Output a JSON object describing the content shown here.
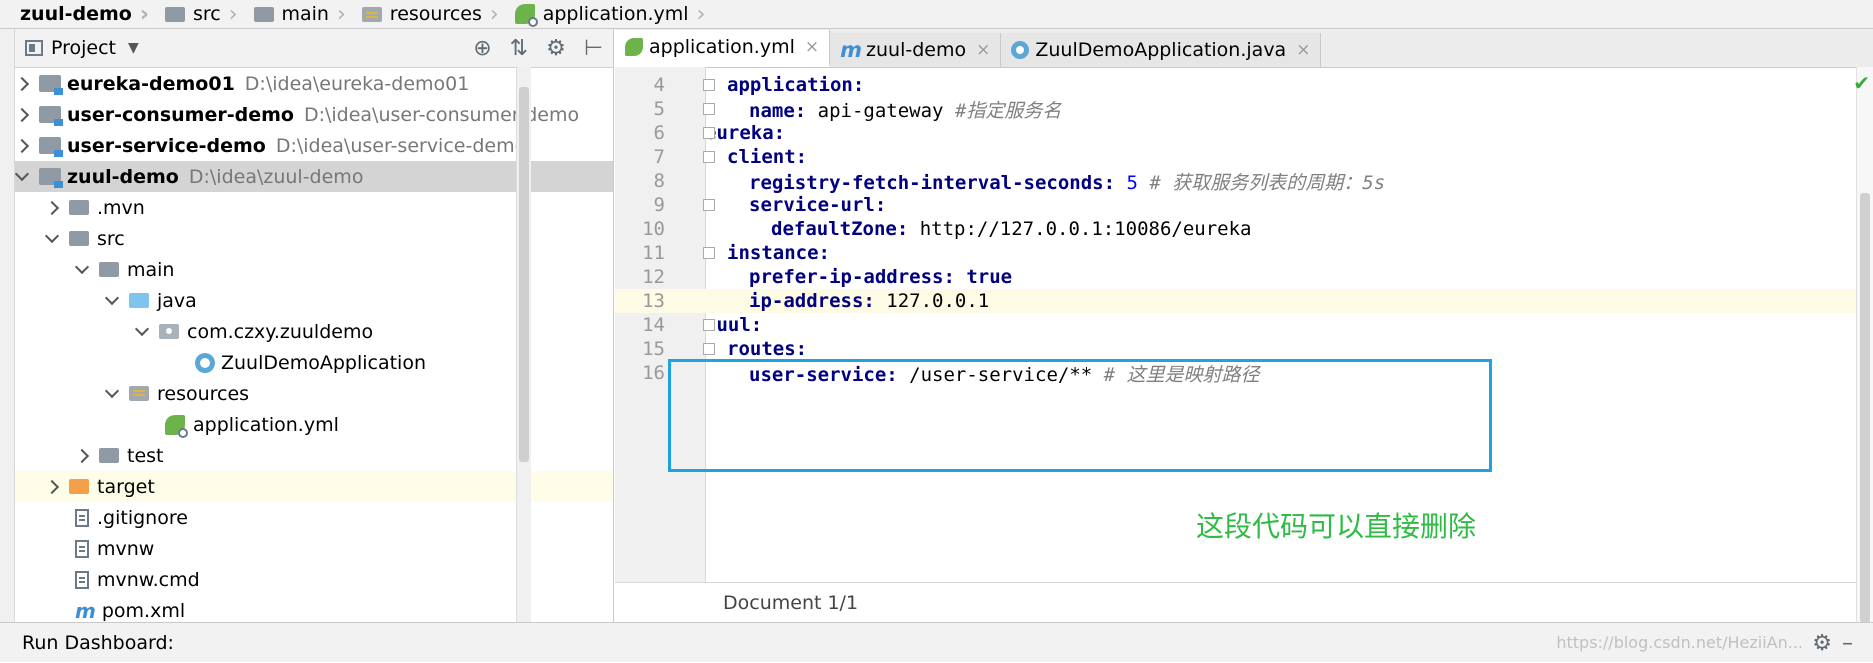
{
  "breadcrumb": [
    "zuul-demo",
    "src",
    "main",
    "resources",
    "application.yml"
  ],
  "project_panel": {
    "title": "Project",
    "tree": [
      {
        "label": "eureka-demo01",
        "path": "D:\\idea\\eureka-demo01",
        "type": "module",
        "expanded": false
      },
      {
        "label": "user-consumer-demo",
        "path": "D:\\idea\\user-consumer-demo",
        "type": "module",
        "expanded": false
      },
      {
        "label": "user-service-demo",
        "path": "D:\\idea\\user-service-demo",
        "type": "module",
        "expanded": false
      },
      {
        "label": "zuul-demo",
        "path": "D:\\idea\\zuul-demo",
        "type": "module",
        "expanded": true,
        "selected": true
      },
      {
        "label": ".mvn",
        "type": "folder"
      },
      {
        "label": "src",
        "type": "folder"
      },
      {
        "label": "main",
        "type": "folder"
      },
      {
        "label": "java",
        "type": "source-folder"
      },
      {
        "label": "com.czxy.zuuldemo",
        "type": "package"
      },
      {
        "label": "ZuulDemoApplication",
        "type": "class"
      },
      {
        "label": "resources",
        "type": "resources-folder"
      },
      {
        "label": "application.yml",
        "type": "yml"
      },
      {
        "label": "test",
        "type": "folder"
      },
      {
        "label": "target",
        "type": "excluded-folder"
      },
      {
        "label": ".gitignore",
        "type": "file"
      },
      {
        "label": "mvnw",
        "type": "file"
      },
      {
        "label": "mvnw.cmd",
        "type": "file"
      },
      {
        "label": "pom.xml",
        "type": "maven"
      }
    ]
  },
  "editor": {
    "tabs": [
      {
        "label": "application.yml",
        "active": true,
        "close": "×"
      },
      {
        "label": "zuul-demo",
        "active": false,
        "close": "×"
      },
      {
        "label": "ZuulDemoApplication.java",
        "active": false,
        "close": "×"
      }
    ],
    "lines": [
      {
        "n": "4",
        "indent": 1,
        "key": "application:",
        "value": "",
        "comment": ""
      },
      {
        "n": "5",
        "indent": 2,
        "key": "name:",
        "value": "api-gateway",
        "comment": "#指定服务名"
      },
      {
        "n": "6",
        "indent": 0,
        "key": "eureka:",
        "value": "",
        "comment": ""
      },
      {
        "n": "7",
        "indent": 1,
        "key": "client:",
        "value": "",
        "comment": ""
      },
      {
        "n": "8",
        "indent": 2,
        "key": "registry-fetch-interval-seconds:",
        "value": "5",
        "comment": "# 获取服务列表的周期：5s",
        "numeric": true
      },
      {
        "n": "9",
        "indent": 2,
        "key": "service-url:",
        "value": "",
        "comment": ""
      },
      {
        "n": "10",
        "indent": 3,
        "key": "defaultZone:",
        "value": "http://127.0.0.1:10086/eureka",
        "comment": ""
      },
      {
        "n": "11",
        "indent": 1,
        "key": "instance:",
        "value": "",
        "comment": ""
      },
      {
        "n": "12",
        "indent": 2,
        "key": "prefer-ip-address:",
        "value": "true",
        "comment": "",
        "keyword": true
      },
      {
        "n": "13",
        "indent": 2,
        "key": "ip-address:",
        "value": "127.0.0.1",
        "comment": "",
        "current": true
      },
      {
        "n": "14",
        "indent": 0,
        "key": "zuul:",
        "value": "",
        "comment": ""
      },
      {
        "n": "15",
        "indent": 1,
        "key": "routes:",
        "value": "",
        "comment": ""
      },
      {
        "n": "16",
        "indent": 2,
        "key": "user-service:",
        "value": "/user-service/**",
        "comment": "# 这里是映射路径"
      }
    ],
    "status": "Document 1/1",
    "annotation": "这段代码可以直接删除",
    "inspection_icon": "check-icon"
  },
  "bottom_bar": {
    "label": "Run Dashboard:",
    "watermark": "https://blog.csdn.net/HeziiAn..."
  },
  "colors": {
    "highlight_box": "#1ca3e0",
    "annotation": "#2fbb44",
    "key": "#000080",
    "comment": "#808080"
  }
}
